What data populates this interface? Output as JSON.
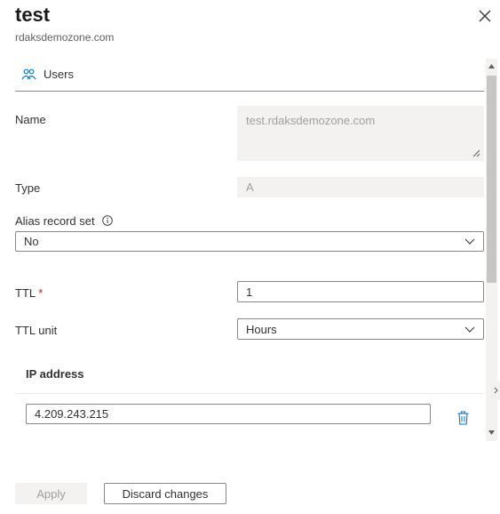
{
  "header": {
    "title": "test",
    "subtitle": "rdaksdemozone.com",
    "close_icon": "close-icon"
  },
  "tabs": [
    {
      "label": "Users",
      "icon": "users-icon"
    }
  ],
  "form": {
    "name": {
      "label": "Name",
      "value": "test.rdaksdemozone.com"
    },
    "type": {
      "label": "Type",
      "value": "A"
    },
    "alias": {
      "label": "Alias record set",
      "value": "No",
      "info_icon": "info-icon"
    },
    "ttl": {
      "label": "TTL",
      "required_mark": "*",
      "value": "1"
    },
    "ttl_unit": {
      "label": "TTL unit",
      "value": "Hours"
    }
  },
  "ip_section": {
    "title": "IP address",
    "rows": [
      {
        "value": "4.209.243.215",
        "delete_icon": "trash-icon"
      }
    ]
  },
  "footer": {
    "apply_label": "Apply",
    "discard_label": "Discard changes"
  },
  "colors": {
    "accent": "#0078d4",
    "border": "#8a8886",
    "disabled_bg": "#f3f2f1",
    "disabled_text": "#a19f9d"
  }
}
